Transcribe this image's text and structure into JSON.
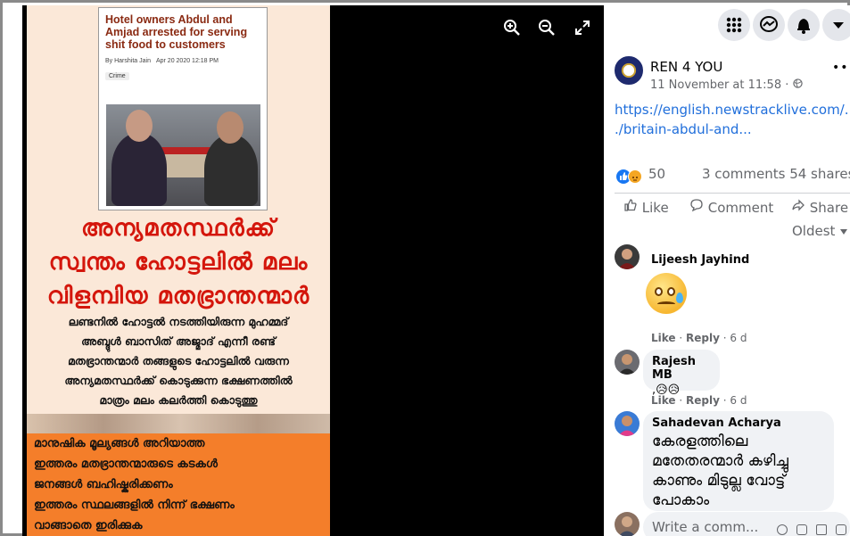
{
  "viewer": {
    "clipping": {
      "headline": "Hotel owners Abdul and Amjad arrested for serving shit food to customers",
      "author": "By Harshita Jain",
      "date": "Apr 20 2020 12:18 PM",
      "category": "Crime"
    },
    "poster_big": [
      "അന്യമതസ്ഥർക്ക്",
      "സ്വന്തം ഹോട്ടലിൽ മലം",
      "വിളമ്പിയ മതഭ്രാന്തന്മാർ"
    ],
    "poster_small": [
      "ലണ്ടനിൽ ഹോട്ടൽ നടത്തിയിരുന്ന മുഹമ്മദ്",
      "അബ്ദുൾ ബാസിത് അജ്മാദ് എന്നീ രണ്ട്",
      "മതഭ്രാന്തന്മാർ തങ്ങളുടെ ഹോട്ടലിൽ വരുന്ന",
      "അന്യമതസ്ഥർക്ക് കൊടുക്കുന്ന ഭക്ഷണത്തിൽ",
      "മാത്രം മലം കലർത്തി കൊടുത്തു"
    ],
    "poster_orange": [
      "മാനുഷിക മൂല്യങ്ങൾ അറിയാത്ത",
      "ഇത്തരം മതഭ്രാന്തന്മാരുടെ കടകൾ",
      "ജനങ്ങൾ ബഹിഷ്കരിക്കണം",
      "ഇത്തരം സ്ഥലങ്ങളിൽ നിന്ന് ഭക്ഷണം",
      "വാങ്ങാതെ ഇരിക്കുക"
    ],
    "controls": [
      "zoom-in-icon",
      "zoom-out-icon",
      "fullscreen-icon"
    ]
  },
  "post": {
    "page_name": "REN 4 YOU",
    "timestamp": "11 November at 11:58",
    "privacy_separator": "·",
    "link_line1": "https://english.newstracklive.com/...",
    "link_line2": "./britain-abdul-and...",
    "reaction_count": "50",
    "comments": "3 comments",
    "shares": "54 shares",
    "actions": {
      "like": "Like",
      "comment": "Comment",
      "share": "Share"
    },
    "sort": "Oldest"
  },
  "comments": [
    {
      "name": "Lijeesh Jayhind",
      "like": "Like",
      "reply": "Reply",
      "time": "6 d"
    },
    {
      "name": "Rajesh MB",
      "text": ",😥😥",
      "like": "Like",
      "reply": "Reply",
      "time": "6 d"
    },
    {
      "name": "Sahadevan Acharya",
      "lines": [
        "കേരളത്തിലെ",
        "മതേതരന്മാർ കഴിച്ചു",
        "കാണും മിടുല്ല വോട്ട്",
        "പോകാം"
      ]
    }
  ],
  "composer": {
    "placeholder": "Write a comm..."
  },
  "colors": {
    "link": "#216fdb",
    "poster_red": "#d4160c",
    "poster_orange": "#f47e2a"
  }
}
